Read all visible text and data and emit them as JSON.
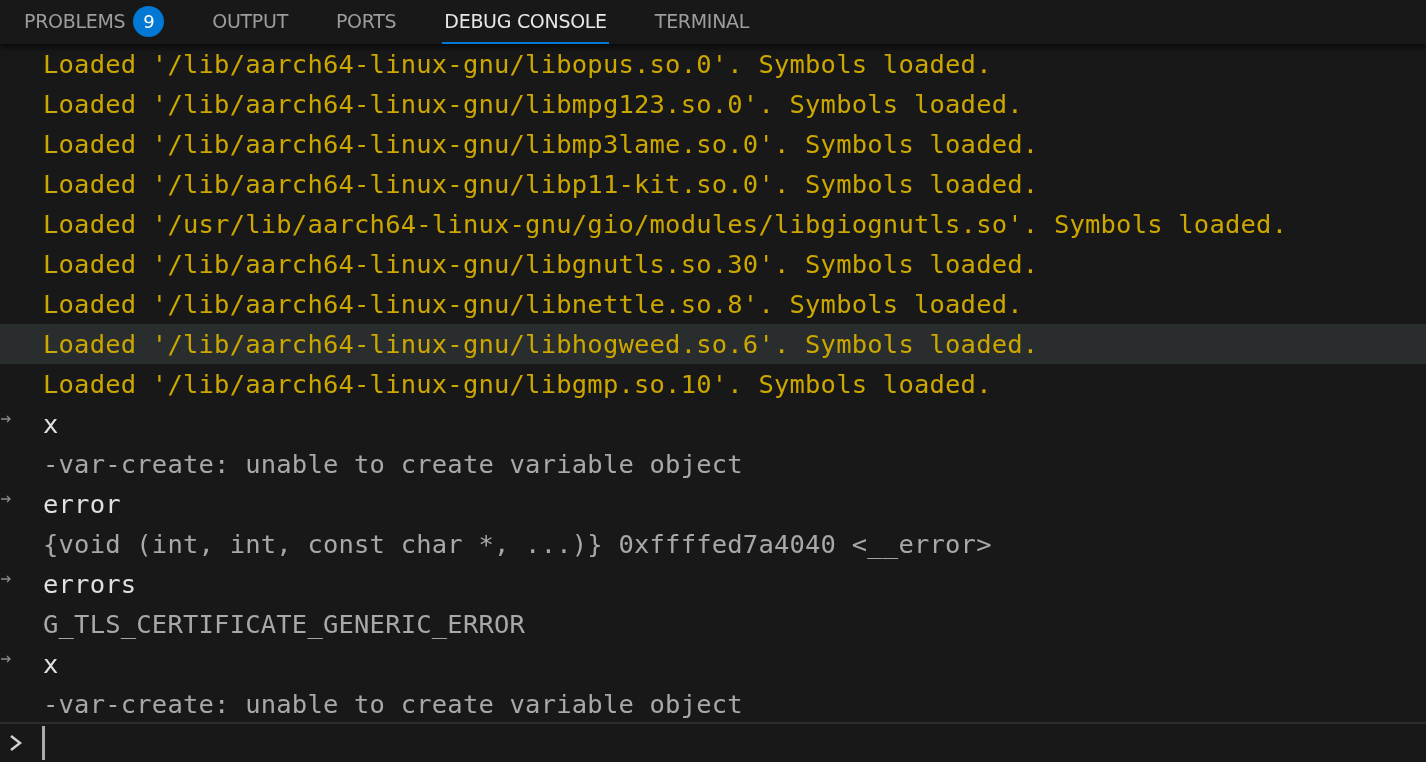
{
  "tabs": [
    {
      "label": "PROBLEMS",
      "badge": "9",
      "selected": false
    },
    {
      "label": "OUTPUT",
      "selected": false
    },
    {
      "label": "PORTS",
      "selected": false
    },
    {
      "label": "DEBUG CONSOLE",
      "selected": true
    },
    {
      "label": "TERMINAL",
      "selected": false
    }
  ],
  "console": [
    {
      "kind": "output",
      "text": "Loaded '/lib/aarch64-linux-gnu/libopus.so.0'. Symbols loaded.",
      "highlighted": false
    },
    {
      "kind": "output",
      "text": "Loaded '/lib/aarch64-linux-gnu/libmpg123.so.0'. Symbols loaded.",
      "highlighted": false
    },
    {
      "kind": "output",
      "text": "Loaded '/lib/aarch64-linux-gnu/libmp3lame.so.0'. Symbols loaded.",
      "highlighted": false
    },
    {
      "kind": "output",
      "text": "Loaded '/lib/aarch64-linux-gnu/libp11-kit.so.0'. Symbols loaded.",
      "highlighted": false
    },
    {
      "kind": "output",
      "text": "Loaded '/usr/lib/aarch64-linux-gnu/gio/modules/libgiognutls.so'. Symbols loaded.",
      "highlighted": false
    },
    {
      "kind": "output",
      "text": "Loaded '/lib/aarch64-linux-gnu/libgnutls.so.30'. Symbols loaded.",
      "highlighted": false
    },
    {
      "kind": "output",
      "text": "Loaded '/lib/aarch64-linux-gnu/libnettle.so.8'. Symbols loaded.",
      "highlighted": false
    },
    {
      "kind": "output",
      "text": "Loaded '/lib/aarch64-linux-gnu/libhogweed.so.6'. Symbols loaded.",
      "highlighted": true
    },
    {
      "kind": "output",
      "text": "Loaded '/lib/aarch64-linux-gnu/libgmp.so.10'. Symbols loaded.",
      "highlighted": false
    },
    {
      "kind": "input",
      "text": "x",
      "highlighted": false
    },
    {
      "kind": "result",
      "text": "-var-create: unable to create variable object",
      "highlighted": false
    },
    {
      "kind": "input",
      "text": "error",
      "highlighted": false
    },
    {
      "kind": "result",
      "text": "{void (int, int, const char *, ...)} 0xffffed7a4040 <__error>",
      "highlighted": false
    },
    {
      "kind": "input",
      "text": "errors",
      "highlighted": false
    },
    {
      "kind": "result",
      "text": "G_TLS_CERTIFICATE_GENERIC_ERROR",
      "highlighted": false
    },
    {
      "kind": "input",
      "text": "x",
      "highlighted": false
    },
    {
      "kind": "result",
      "text": "-var-create: unable to create variable object",
      "highlighted": false
    }
  ]
}
